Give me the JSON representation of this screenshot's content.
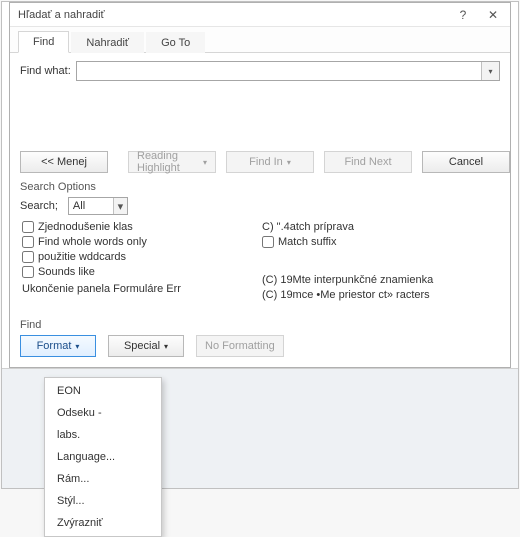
{
  "title": "Hľadať a nahradiť",
  "tabs": {
    "find": "Find",
    "replace": "Nahradiť",
    "goto": "Go To"
  },
  "find_what_label": "Find what:",
  "find_what_value": "",
  "buttons": {
    "less": "<< Menej",
    "reading_highlight": "Reading Highlight",
    "find_in": "Find In",
    "find_next": "Find Next",
    "cancel": "Cancel"
  },
  "search_options_label": "Search Options",
  "search_label": "Search;",
  "search_scope": "All",
  "left_checks": [
    "Zjednodušenie klas",
    "Find whole words only",
    "použitie wddcards",
    "Sounds like"
  ],
  "left_extra": "Ukončenie panela Formuláre Err",
  "right_col": {
    "match_prefix": "C) \".4atch príprava",
    "match_suffix": "Match suffix",
    "ignore_punct": "(C) 19Mte interpunkčné znamienka",
    "ignore_space": "(C) 19mce •Me priestor ct» racters"
  },
  "find_section_label": "Find",
  "bottom_buttons": {
    "format": "Format",
    "special": "Special",
    "no_formatting": "No Formatting"
  },
  "format_menu": [
    "EON",
    "Odseku -",
    "labs.",
    "Language...",
    "Rám...",
    "Stýl...",
    "Zvýrazniť"
  ]
}
